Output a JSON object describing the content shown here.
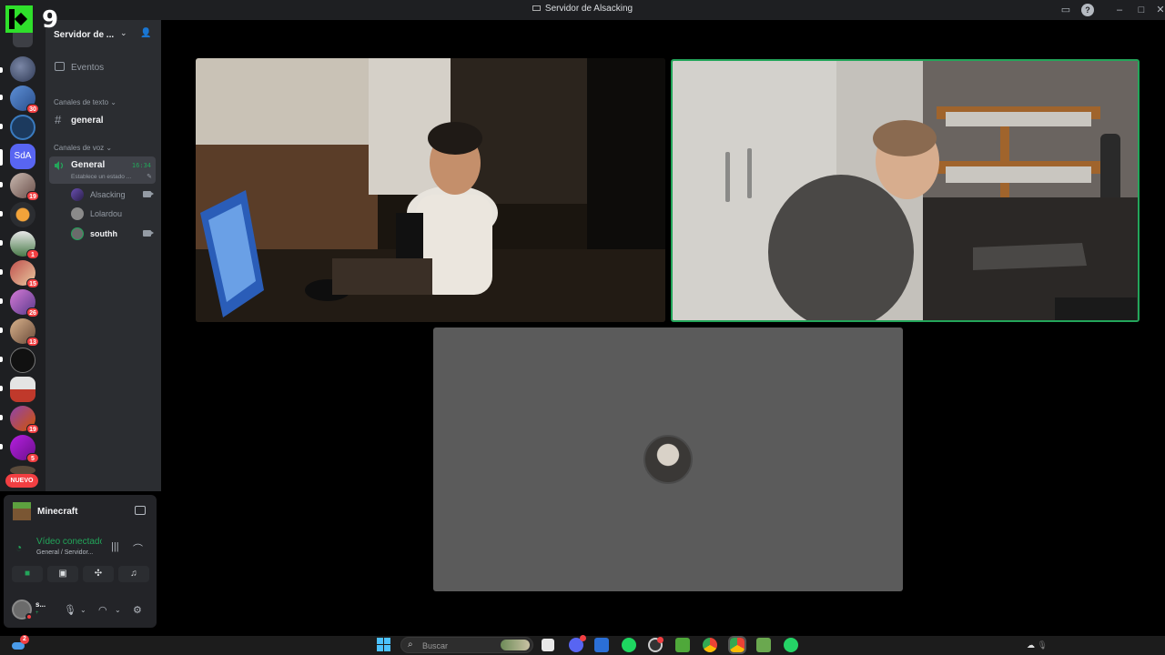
{
  "window": {
    "title": "Servidor de Alsacking",
    "controls": [
      "inbox-icon",
      "help-icon",
      "minimize",
      "maximize",
      "close"
    ]
  },
  "overlay": {
    "number": "9"
  },
  "server_rail": {
    "badges": [
      "30",
      "19",
      "1",
      "15",
      "26",
      "13",
      "19",
      "5"
    ],
    "sda_label": "SdA",
    "nuevo_label": "NUEVO"
  },
  "sidebar": {
    "server_name": "Servidor de ...",
    "events_label": "Eventos",
    "text_category": "Canales de texto",
    "text_channel": "general",
    "voice_category": "Canales de voz",
    "voice_channel": {
      "name": "General",
      "timer": "16:34",
      "status_placeholder": "Establece un estado ..."
    },
    "voice_users": [
      {
        "name": "Alsacking",
        "camera": true,
        "bold": false
      },
      {
        "name": "Lolardou",
        "camera": false,
        "bold": false
      },
      {
        "name": "southh",
        "camera": true,
        "bold": true
      }
    ]
  },
  "panel": {
    "game_name": "Minecraft",
    "connection_status": "Vídeo conectado",
    "connection_location": "General / Servidor...",
    "user_name": "s...",
    "user_status": "+"
  },
  "taskbar": {
    "search_placeholder": "Buscar",
    "notification_count": "2",
    "apps": [
      "file-explorer-icon",
      "discord-icon",
      "store-icon",
      "spotify-icon",
      "obs-icon",
      "minecraft-icon",
      "chrome-icon",
      "chrome-work-icon",
      "minecraft-launcher-icon",
      "whatsapp-icon"
    ]
  },
  "colors": {
    "accent_green": "#23a55a",
    "badge_red": "#f23f42",
    "sidebar_bg": "#2b2d31",
    "rail_bg": "#1e1f22"
  }
}
